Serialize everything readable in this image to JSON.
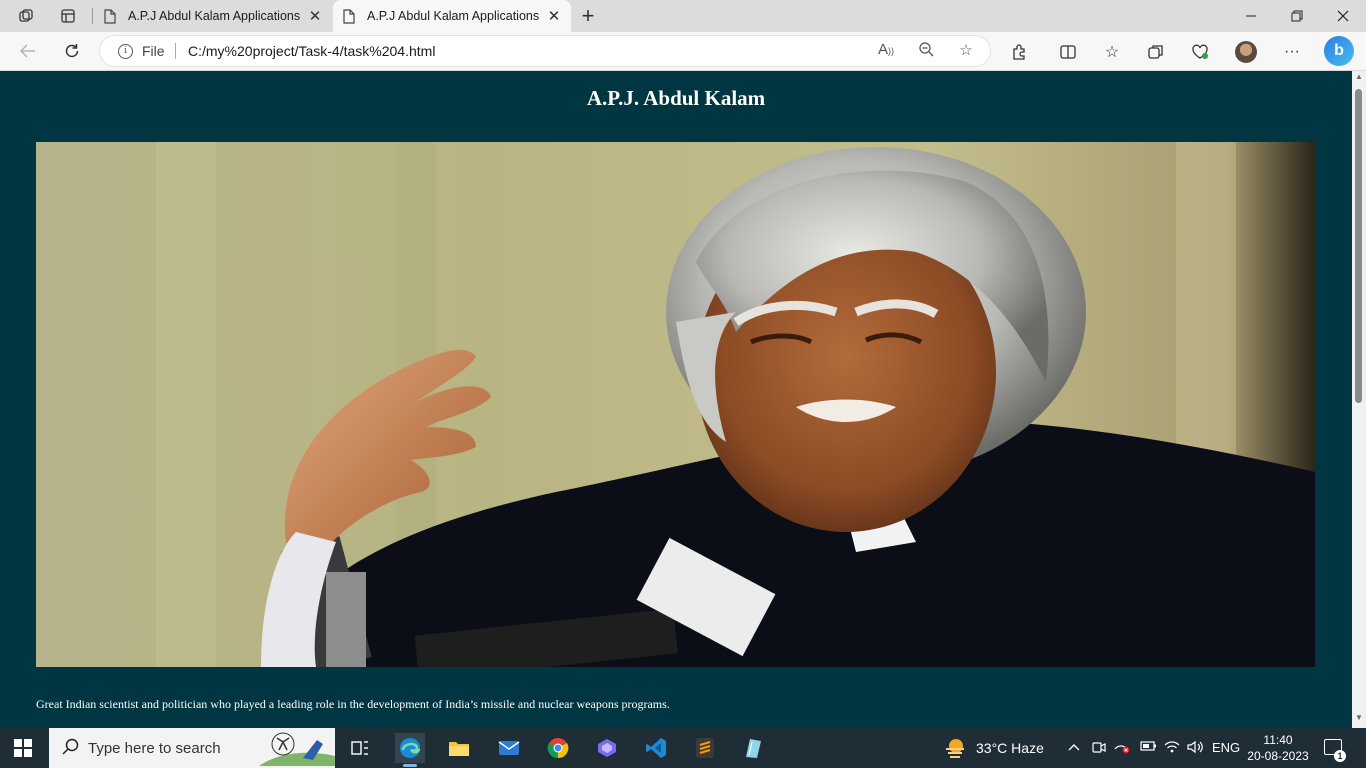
{
  "browser": {
    "tabs": [
      {
        "title": "A.P.J Abdul Kalam Applications",
        "active": false
      },
      {
        "title": "A.P.J Abdul Kalam Applications",
        "active": true
      }
    ],
    "site_label": "File",
    "url": "C:/my%20project/Task-4/task%204.html",
    "bing_label": "b"
  },
  "page": {
    "heading": "A.P.J. Abdul Kalam",
    "image_alt": "Portrait of A.P.J. Abdul Kalam speaking at microphones",
    "description": "Great Indian scientist and politician who played a leading role in the development of India’s missile and nuclear weapons programs."
  },
  "taskbar": {
    "search_placeholder": "Type here to search",
    "weather": "33°C  Haze",
    "language": "ENG",
    "time": "11:40",
    "date": "20-08-2023",
    "notification_count": "1"
  },
  "colors": {
    "page_background": "#003542",
    "heading_text": "#ffffff",
    "taskbar": "#1f2d36"
  }
}
